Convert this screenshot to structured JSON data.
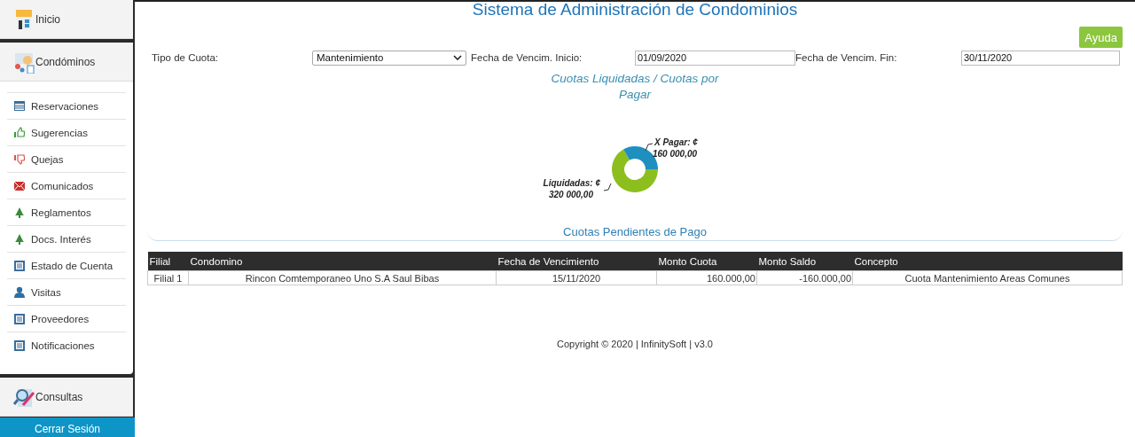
{
  "sidebar": {
    "sections": [
      {
        "label": "Inicio"
      },
      {
        "label": "Condóminos",
        "items": [
          {
            "label": "Reservaciones"
          },
          {
            "label": "Sugerencias"
          },
          {
            "label": "Quejas"
          },
          {
            "label": "Comunicados"
          },
          {
            "label": "Reglamentos"
          },
          {
            "label": "Docs. Interés"
          },
          {
            "label": "Estado de Cuenta"
          },
          {
            "label": "Visitas"
          },
          {
            "label": "Proveedores"
          },
          {
            "label": "Notificaciones"
          }
        ]
      },
      {
        "label": "Consultas"
      }
    ],
    "logout": "Cerrar Sesión"
  },
  "title": "Sistema de Administración de Condominios",
  "help_button": "Ayuda",
  "filters": [
    {
      "kind": "select",
      "label": "Tipo de Cuota:",
      "value": "Mantenimiento"
    },
    {
      "kind": "date",
      "label": "Fecha de Vencim. Inicio:",
      "value": "01/09/2020"
    },
    {
      "kind": "date",
      "label": "Fecha de Vencim. Fin:",
      "value": "30/11/2020"
    }
  ],
  "chart": {
    "chart_data": {
      "type": "donut",
      "title": "Cuotas Liquidadas / Cuotas por Pagar",
      "categories": [
        "Liquidadas: ¢",
        "X Pagar: ¢"
      ],
      "values": [
        320000,
        160000
      ],
      "colors": [
        "#8cbf1e",
        "#1f8fbf"
      ],
      "value_labels": [
        "320 000,00",
        "160 000,00"
      ]
    }
  },
  "pending": {
    "title": "Cuotas Pendientes de Pago",
    "columns": [
      "Filial",
      "Condomino",
      "Fecha de Vencimiento",
      "Monto Cuota",
      "Monto Saldo",
      "Concepto"
    ],
    "rows": [
      [
        "Filial 1",
        "Rincon Comtemporaneo Uno S.A Saul Bibas",
        "15/11/2020",
        "160.000,00",
        "-160.000,00",
        "Cuota Mantenimiento Areas Comunes"
      ]
    ]
  },
  "footer": "Copyright © 2020 | InfinitySoft | v3.0"
}
